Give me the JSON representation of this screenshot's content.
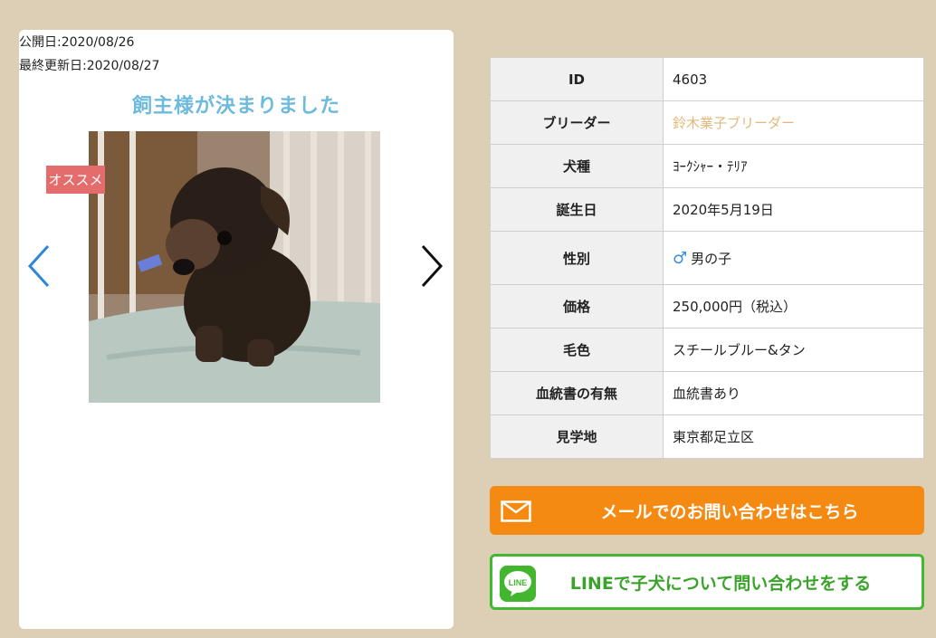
{
  "listing": {
    "published": "公開日:2020/08/26",
    "updated": "最終更新日:2020/08/27",
    "status_title": "飼主様が決まりました",
    "badge": "オススメ",
    "photo_icon": "puppy-photo"
  },
  "specs": [
    {
      "label": "ID",
      "value": "4603"
    },
    {
      "label": "ブリーダー",
      "value": "鈴木業子ブリーダー"
    },
    {
      "label": "犬種",
      "value": "ﾖｰｸｼｬｰ・ﾃﾘｱ"
    },
    {
      "label": "誕生日",
      "value": "2020年5月19日"
    },
    {
      "label": "性別",
      "value": "男の子",
      "icon": "♂"
    },
    {
      "label": "価格",
      "value": "250,000円（税込）"
    },
    {
      "label": "毛色",
      "value": "スチールブルー&タン"
    },
    {
      "label": "血統書の有無",
      "value": "血統書あり"
    },
    {
      "label": "見学地",
      "value": "東京都足立区"
    }
  ],
  "contact": {
    "mail_label": "メールでのお問い合わせはこちら",
    "line_label": "LINEで子犬について問い合わせをする",
    "line_icon_text": "LINE"
  },
  "colors": {
    "background": "#dccfb6",
    "title": "#6dbadd",
    "badge": "#e46c6c",
    "mail_button": "#f58a12",
    "line_green": "#43b92f",
    "breeder_link": "#e2b97c"
  }
}
